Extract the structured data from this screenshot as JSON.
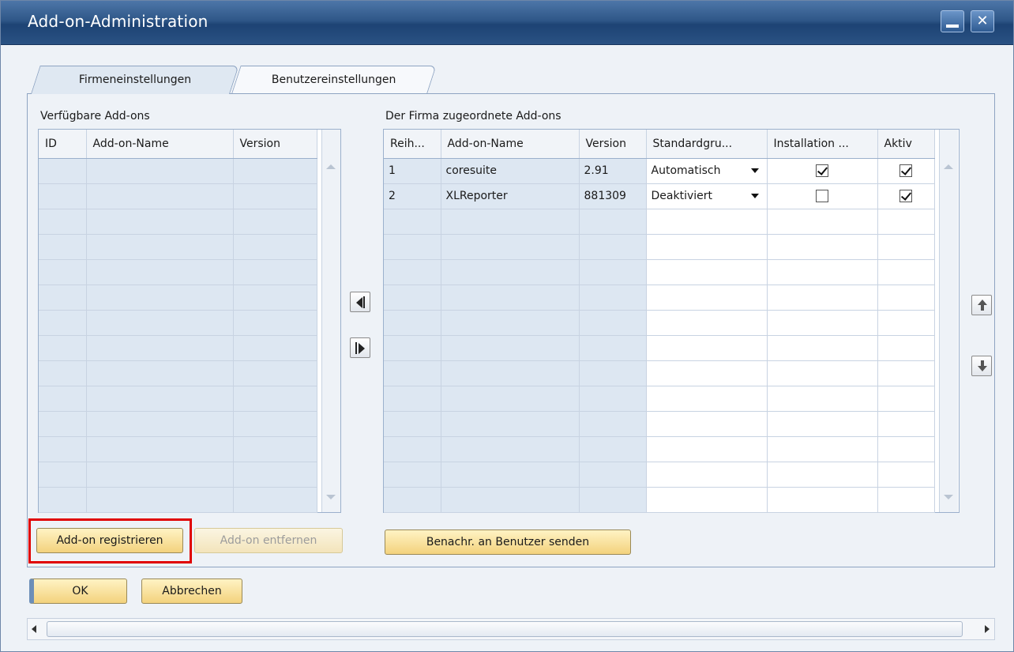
{
  "window": {
    "title": "Add-on-Administration"
  },
  "tabs": [
    {
      "label": "Firmeneinstellungen",
      "active": true
    },
    {
      "label": "Benutzereinstellungen",
      "active": false
    }
  ],
  "available": {
    "title": "Verfügbare Add-ons",
    "columns": [
      "ID",
      "Add-on-Name",
      "Version"
    ],
    "rows": []
  },
  "assigned": {
    "title": "Der Firma zugeordnete Add-ons",
    "columns": [
      "Reih...",
      "Add-on-Name",
      "Version",
      "Standardgru...",
      "Installation ...",
      "Aktiv"
    ],
    "rows": [
      {
        "row": "1",
        "name": "coresuite",
        "version": "2.91",
        "group": "Automatisch",
        "installation": true,
        "active": true
      },
      {
        "row": "2",
        "name": "XLReporter",
        "version": "881309",
        "group": "Deaktiviert",
        "installation": false,
        "active": true
      }
    ]
  },
  "buttons": {
    "register": "Add-on registrieren",
    "remove": "Add-on entfernen",
    "notify": "Benachr. an Benutzer senden",
    "ok": "OK",
    "cancel": "Abbrechen"
  },
  "icons": {
    "move_left": "arrow-left-icon",
    "move_right": "arrow-right-icon",
    "move_up": "arrow-up-icon",
    "move_down": "arrow-down-icon"
  },
  "colors": {
    "titlebar": "#2f5788",
    "button": "#f3d27d",
    "highlight": "#e00000"
  }
}
